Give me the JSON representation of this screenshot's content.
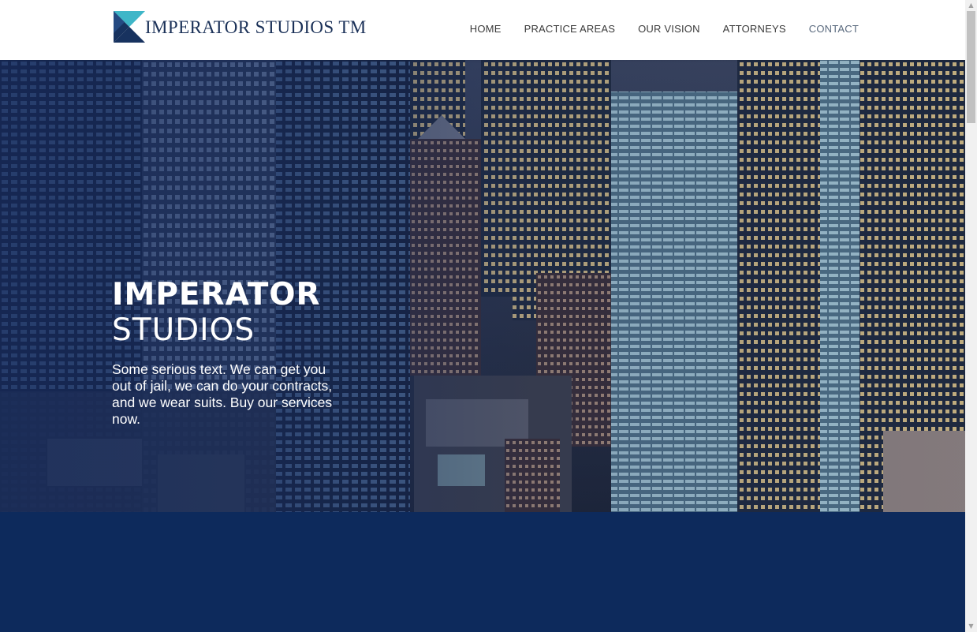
{
  "header": {
    "logo_text": "IMPERATOR STUDIOS TM",
    "nav": [
      {
        "label": "HOME"
      },
      {
        "label": "PRACTICE AREAS"
      },
      {
        "label": "OUR VISION"
      },
      {
        "label": "ATTORNEYS"
      },
      {
        "label": "CONTACT"
      }
    ]
  },
  "hero": {
    "title_line1": "IMPERATOR",
    "title_line2": "STUDIOS",
    "body": "Some serious text. We can get you out of jail, we can do your contracts, and we wear suits. Buy our services now."
  },
  "colors": {
    "brand_navy": "#0d2a5c",
    "logo_teal": "#3fb6c8",
    "logo_dark": "#17325f"
  },
  "icons": {
    "logo_mark": "logo-mark-icon",
    "scroll_up": "chevron-up-icon",
    "scroll_down": "chevron-down-icon"
  }
}
